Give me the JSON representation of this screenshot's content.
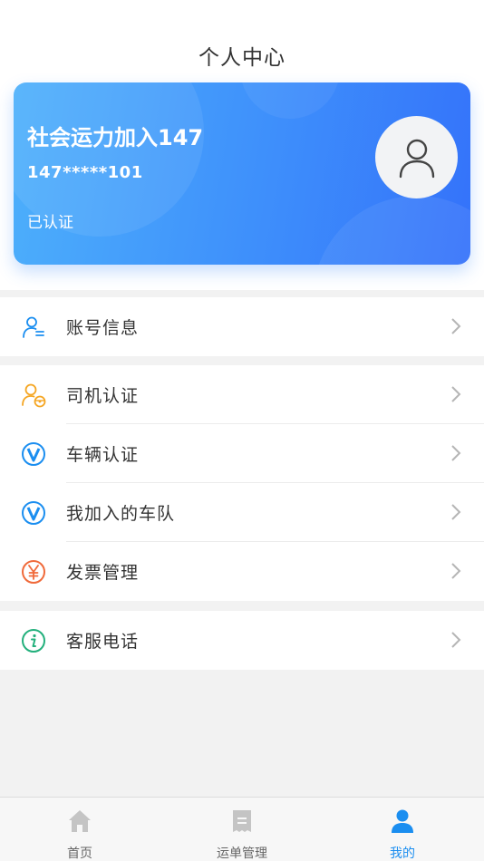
{
  "header": {
    "title": "个人中心"
  },
  "profile": {
    "name": "社会运力加入147",
    "phone": "147*****101",
    "status": "已认证"
  },
  "menu": {
    "account": {
      "label": "账号信息",
      "icon": "user-list-icon"
    },
    "driver_auth": {
      "label": "司机认证",
      "icon": "driver-icon"
    },
    "vehicle_auth": {
      "label": "车辆认证",
      "icon": "v-badge-icon"
    },
    "my_fleet": {
      "label": "我加入的车队",
      "icon": "v-badge-icon"
    },
    "invoice": {
      "label": "发票管理",
      "icon": "yen-icon"
    },
    "service_phone": {
      "label": "客服电话",
      "icon": "info-icon"
    }
  },
  "tabs": [
    {
      "label": "首页",
      "icon": "home-icon"
    },
    {
      "label": "运单管理",
      "icon": "receipt-icon"
    },
    {
      "label": "我的",
      "icon": "person-icon",
      "active": true
    }
  ],
  "colors": {
    "accent": "#1b8ef0",
    "card_start": "#4db0fb",
    "card_end": "#3472fa",
    "driver_icon": "#f5a623",
    "invoice_icon": "#f06a3a",
    "info_icon": "#23b07c"
  }
}
